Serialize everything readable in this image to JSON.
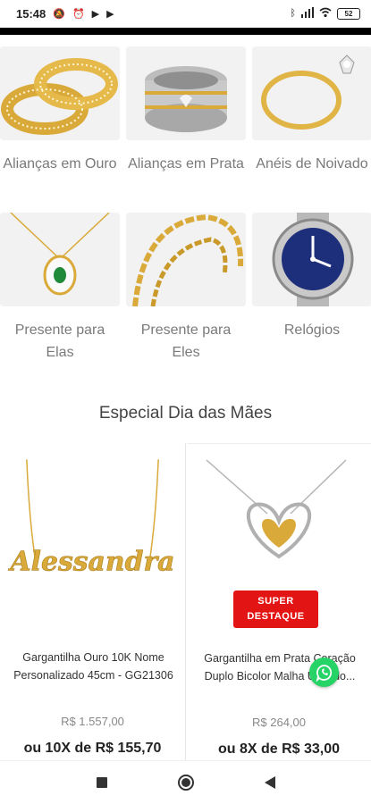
{
  "status_bar": {
    "time": "15:48",
    "battery": "52"
  },
  "categories": [
    {
      "label": "Alianças em Ouro",
      "icon": "gold-rings-image"
    },
    {
      "label": "Alianças em Prata",
      "icon": "silver-rings-image"
    },
    {
      "label": "Anéis de Noivado",
      "icon": "engagement-ring-image"
    },
    {
      "label": "Presente para Elas",
      "icon": "necklace-image"
    },
    {
      "label": "Presente para Eles",
      "icon": "chain-image"
    },
    {
      "label": "Relógios",
      "icon": "watch-image"
    }
  ],
  "section": {
    "title": "Especial Dia das Mães"
  },
  "products": [
    {
      "name": "Gargantilha Ouro 10K Nome Personalizado 45cm - GG21306",
      "pendant_text": "Alessandra",
      "old_price": "R$ 1.557,00",
      "installments": "ou 10X de R$ 155,70"
    },
    {
      "name": "Gargantilha em Prata Coração Duplo Bicolor Malha Us... do...",
      "badge": "SUPER DESTAQUE",
      "old_price": "R$ 264,00",
      "installments": "ou 8X de R$ 33,00"
    }
  ],
  "colors": {
    "badge": "#e31414",
    "whatsapp": "#25d366",
    "gold": "#d9aa3a"
  }
}
